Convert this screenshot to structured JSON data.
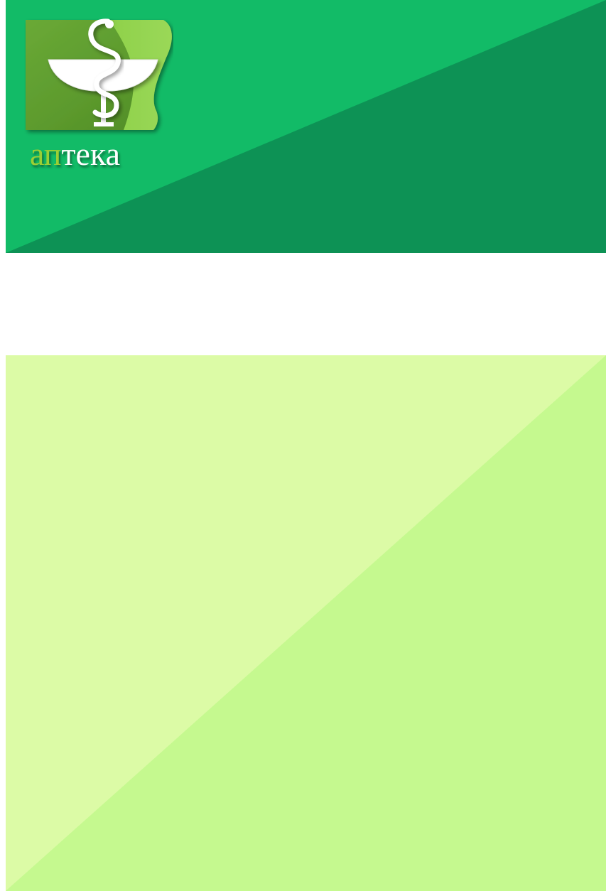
{
  "logo": {
    "text_part_1": "ап",
    "text_part_2": "тека",
    "icon": "bowl-of-hygieia-icon"
  },
  "colors": {
    "banner_light": "#12bb67",
    "banner_dark": "#0d9255",
    "logo_green_dark": "#5a9a2c",
    "logo_green_light": "#92d34a",
    "logo_text_accent": "#9ccf34",
    "panel_light": "#dcfba6",
    "panel_dark": "#c5f98f"
  }
}
